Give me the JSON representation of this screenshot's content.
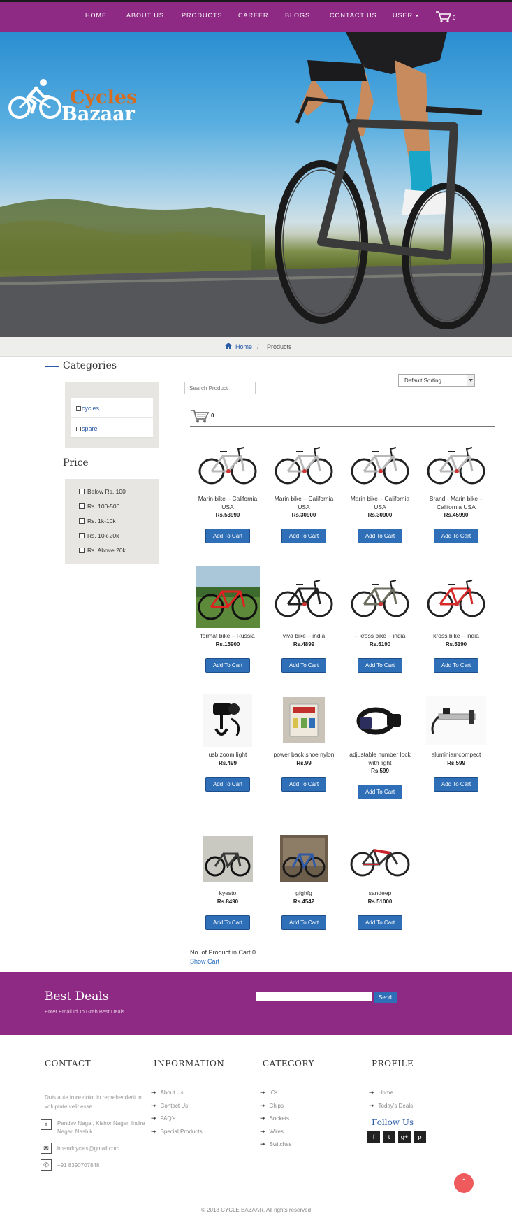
{
  "nav": {
    "items": [
      {
        "label": "HOME"
      },
      {
        "label": "ABOUT US"
      },
      {
        "label": "PRODUCTS"
      },
      {
        "label": "CAREER"
      },
      {
        "label": "BLOGS"
      },
      {
        "label": "CONTACT US"
      },
      {
        "label": "USER"
      }
    ],
    "cart_count": "0"
  },
  "brand": {
    "line1": "Cycles",
    "line2": "Bazaar"
  },
  "breadcrumb": {
    "home": "Home",
    "separator": "/",
    "current": "Products"
  },
  "sidebar": {
    "categories_title": "Categories",
    "categories": [
      {
        "label": "cycles"
      },
      {
        "label": "spare"
      }
    ],
    "price_title": "Price",
    "prices": [
      {
        "label": "Below Rs. 100"
      },
      {
        "label": "Rs. 100-500"
      },
      {
        "label": "Rs. 1k-10k"
      },
      {
        "label": "Rs. 10k-20k"
      },
      {
        "label": "Rs. Above 20k"
      }
    ]
  },
  "toolbar": {
    "search_placeholder": "Search Product",
    "sort_value": "Default Sorting",
    "cart_count": "0"
  },
  "products": [
    {
      "name": "Marin bike – California USA",
      "price": "Rs.53990",
      "button": "Add To Cart",
      "img": "bike-silver"
    },
    {
      "name": "Marin bike – California USA",
      "price": "Rs.30900",
      "button": "Add To Cart",
      "img": "bike-silver"
    },
    {
      "name": "Marin bike – California USA",
      "price": "Rs.30900",
      "button": "Add To Cart",
      "img": "bike-silver"
    },
    {
      "name": "Brand - Marin bike – California USA",
      "price": "Rs.45990",
      "button": "Add To Cart",
      "img": "bike-silver"
    },
    {
      "name": "format bike – Russia",
      "price": "Rs.15900",
      "button": "Add To Cart",
      "img": "bike-red-grass"
    },
    {
      "name": "viva bike – india",
      "price": "Rs.4899",
      "button": "Add To Cart",
      "img": "bike-black"
    },
    {
      "name": "– kross bike – india",
      "price": "Rs.6190",
      "button": "Add To Cart",
      "img": "bike-grey"
    },
    {
      "name": "kross bike – india",
      "price": "Rs.5190",
      "button": "Add To Cart",
      "img": "bike-red"
    },
    {
      "name": "usb zoom light",
      "price": "Rs.499",
      "button": "Add To Cart",
      "img": "light"
    },
    {
      "name": "power back shoe nylon",
      "price": "Rs.99",
      "button": "Add To Cart",
      "img": "shoe"
    },
    {
      "name": "adjustable number lock with light",
      "price": "Rs.599",
      "button": "Add To Cart",
      "img": "lock"
    },
    {
      "name": "aluminiamcompect",
      "price": "Rs.599",
      "button": "Add To Cart",
      "img": "pump"
    },
    {
      "name": "kyesto",
      "price": "Rs.8490",
      "button": "Add To Cart",
      "img": "bike-photo"
    },
    {
      "name": "gfghfg",
      "price": "Rs.4542",
      "button": "Add To Cart",
      "img": "bike-photo-blue"
    },
    {
      "name": "sandeep",
      "price": "Rs.51000",
      "button": "Add To Cart",
      "img": "bike-red-mtb"
    }
  ],
  "cart_summary": {
    "text": "No. of Product in Cart 0",
    "link": "Show Cart"
  },
  "deals": {
    "title": "Best Deals",
    "subtitle": "Enter Email Id To Grab Best Deals",
    "button": "Send"
  },
  "footer": {
    "contact": {
      "title": "CONTACT",
      "text": "Duis aute irure dolor in reprehenderit in voluptate velit esse.",
      "address": "Pandav Nagar, Kishor Nagar, Indira Nagar, Nashik",
      "email": "bhandcycles@gmail.com",
      "phone": "+91 8390707848"
    },
    "information": {
      "title": "INFORMATION",
      "links": [
        "About Us",
        "Contact Us",
        "FAQ's",
        "Special Products"
      ]
    },
    "category": {
      "title": "CATEGORY",
      "links": [
        "ICs",
        "Chips",
        "Sockets",
        "Wires",
        "Switches"
      ]
    },
    "profile": {
      "title": "PROFILE",
      "links": [
        "Home",
        "Today's Deals"
      ],
      "follow": "Follow Us"
    },
    "copyright": "© 2018 CYCLE BAZAAR. All rights reserved"
  }
}
